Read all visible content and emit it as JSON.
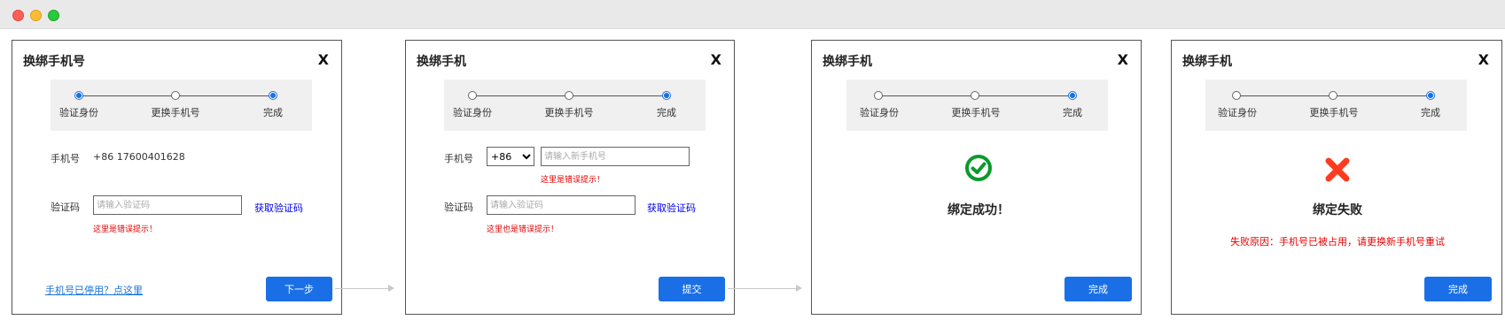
{
  "colors": {
    "accent": "#1a6fe6",
    "error": "#e60000",
    "success": "#0a9a2a",
    "fail": "#ff3b1f"
  },
  "window_controls": [
    "close-dot",
    "minimize-dot",
    "zoom-dot"
  ],
  "panel1": {
    "title": "换绑手机号",
    "close": "X",
    "steps": [
      "验证身份",
      "更换手机号",
      "完成"
    ],
    "phone_label": "手机号",
    "phone_value": "+86  17600401628",
    "code_label": "验证码",
    "code_placeholder": "请输入验证码",
    "get_code": "获取验证码",
    "error": "这里是错误提示！",
    "help_link": "手机号已停用？点这里",
    "next_button": "下一步"
  },
  "panel2": {
    "title": "换绑手机",
    "close": "X",
    "steps": [
      "验证身份",
      "更换手机号",
      "完成"
    ],
    "phone_label": "手机号",
    "country_code": "+86",
    "phone_placeholder": "请输入新手机号",
    "phone_error": "这里是错误提示！",
    "code_label": "验证码",
    "code_placeholder": "请输入验证码",
    "get_code": "获取验证码",
    "code_error": "这里也是错误提示！",
    "submit_button": "提交"
  },
  "panel3": {
    "title": "换绑手机",
    "close": "X",
    "steps": [
      "验证身份",
      "更换手机号",
      "完成"
    ],
    "icon": "check-circle-icon",
    "result": "绑定成功！",
    "done_button": "完成"
  },
  "panel4": {
    "title": "换绑手机",
    "close": "X",
    "steps": [
      "验证身份",
      "更换手机号",
      "完成"
    ],
    "icon": "cross-icon",
    "result": "绑定失败",
    "reason": "失败原因：手机号已被占用，请更换新手机号重试",
    "done_button": "完成"
  }
}
